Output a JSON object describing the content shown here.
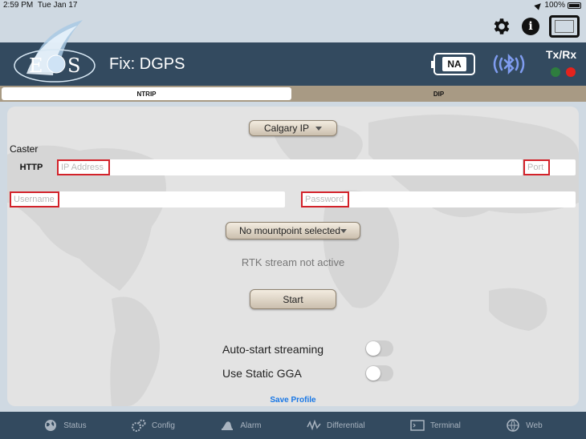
{
  "status_bar": {
    "time": "2:59 PM",
    "date": "Tue Jan 17",
    "battery": "100%"
  },
  "header": {
    "logo_text": "EOS",
    "title": "Fix: DGPS",
    "na_label": "NA",
    "txrx_label": "Tx/Rx",
    "tx_color": "#2e7d3e",
    "rx_color": "#e4231d"
  },
  "top_icons": [
    "gear-icon",
    "info-icon",
    "tablet-icon"
  ],
  "tabs": [
    {
      "label": "NTRIP",
      "active": true
    },
    {
      "label": "DIP",
      "active": false
    }
  ],
  "ntrip": {
    "caster_preset": "Calgary IP",
    "caster_label": "Caster",
    "protocol": "HTTP",
    "ip_placeholder": "IP Address",
    "port_placeholder": "Port",
    "username_placeholder": "Username",
    "password_placeholder": "Password",
    "mountpoint": "No mountpoint selected",
    "rtk_status": "RTK stream not active",
    "start_label": "Start",
    "auto_start_label": "Auto-start streaming",
    "auto_start_on": false,
    "static_gga_label": "Use Static GGA",
    "static_gga_on": false,
    "save_profile_label": "Save Profile"
  },
  "bottom_nav": [
    {
      "label": "Status",
      "icon": "globe-icon"
    },
    {
      "label": "Config",
      "icon": "gears-icon"
    },
    {
      "label": "Alarm",
      "icon": "alarm-icon"
    },
    {
      "label": "Differential",
      "icon": "differential-icon"
    },
    {
      "label": "Terminal",
      "icon": "terminal-icon"
    },
    {
      "label": "Web",
      "icon": "www-icon"
    }
  ],
  "colors": {
    "header_bg": "#334a5f",
    "accent_link": "#1877e6",
    "placeholder_highlight": "#d3222a"
  }
}
